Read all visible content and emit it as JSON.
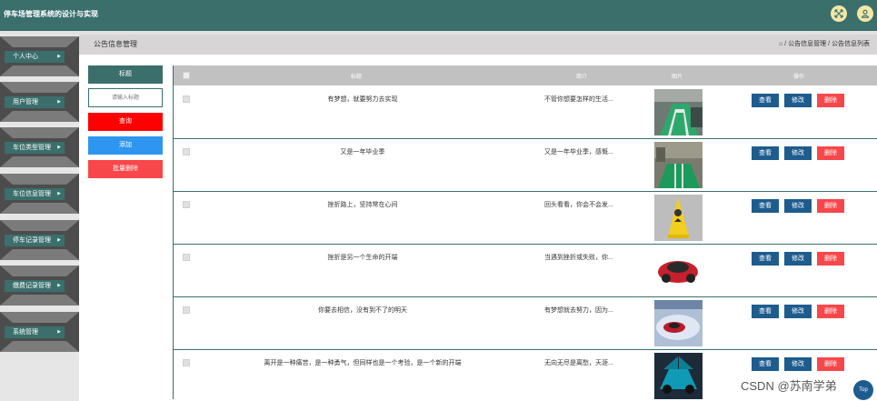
{
  "app": {
    "title": "停车场管理系统的设计与实现"
  },
  "header": {
    "fullscreen_icon": "expand-icon",
    "user_icon": "user-icon"
  },
  "sidebar": {
    "items": [
      {
        "label": "个人中心"
      },
      {
        "label": "用户管理"
      },
      {
        "label": "车位类型管理"
      },
      {
        "label": "车位信息管理"
      },
      {
        "label": "停车记录管理"
      },
      {
        "label": "缴费记录管理"
      },
      {
        "label": "系统管理"
      }
    ]
  },
  "breadcrumb": {
    "page_title": "公告信息管理",
    "path": "⌂ / 公告信息管理 / 公告信息列表"
  },
  "search": {
    "label": "标题",
    "placeholder": "请输入标题",
    "query_label": "查询",
    "add_label": "添加",
    "batch_delete_label": "批量删除"
  },
  "table": {
    "headers": {
      "title": "标题",
      "intro": "简介",
      "image": "图片",
      "action": "操作"
    },
    "actions": {
      "view": "查看",
      "edit": "修改",
      "delete": "删除"
    },
    "rows": [
      {
        "title": "有梦想，就要努力去实现",
        "intro": "不管你想要怎样的生活..."
      },
      {
        "title": "又是一年毕业季",
        "intro": "又是一年毕业季，感慨..."
      },
      {
        "title": "挫折路上，坚持常在心间",
        "intro": "回头看看，你会不会发..."
      },
      {
        "title": "挫折是另一个生命的开端",
        "intro": "当遇到挫折或失败，你..."
      },
      {
        "title": "你要去相信，没有到不了的明天",
        "intro": "有梦想就去努力，因为..."
      },
      {
        "title": "离开是一种痛苦，是一种勇气，但同样也是一个考验，是一个新的开端",
        "intro": "无向无尽是离愁，天涯..."
      }
    ]
  },
  "watermark": "CSDN @苏南学弟",
  "scroll_top_label": "Top"
}
